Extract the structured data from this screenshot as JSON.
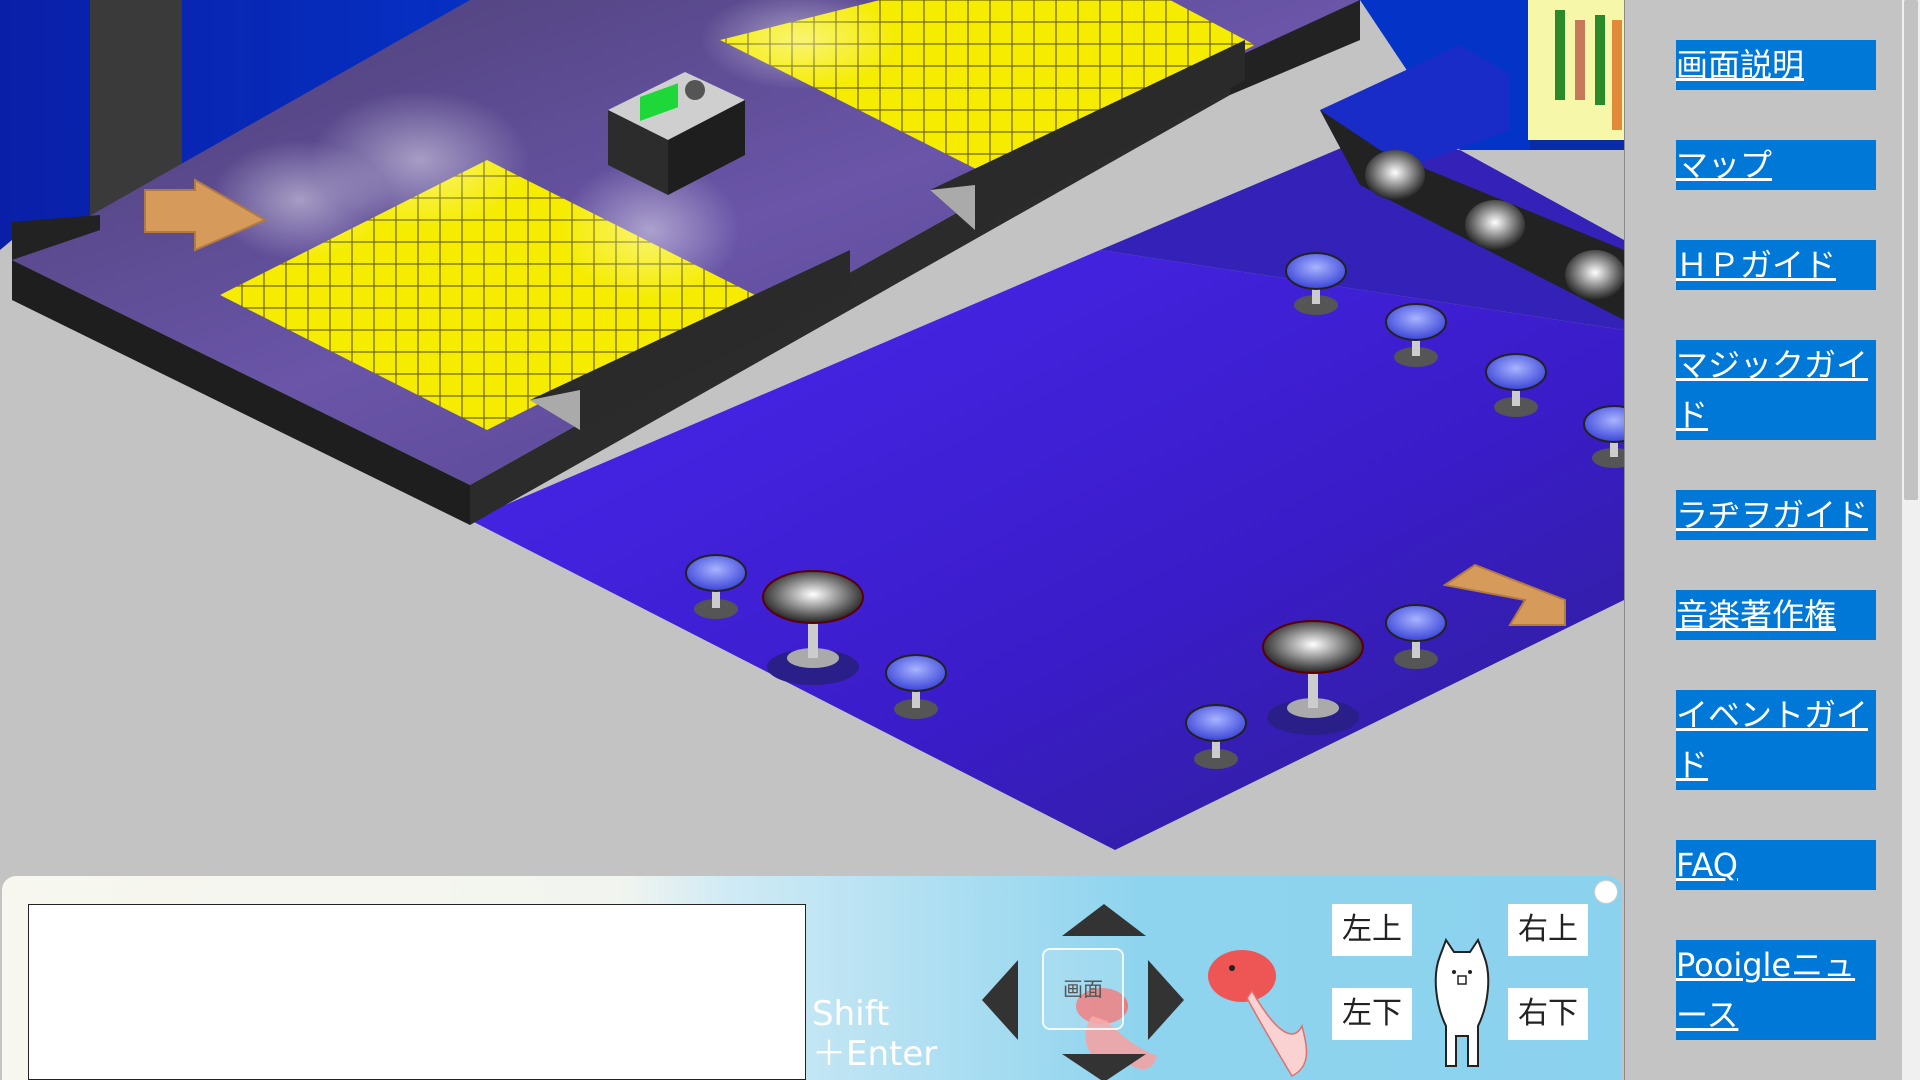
{
  "sidebar": {
    "links": [
      {
        "label": "画面説明"
      },
      {
        "label": "マップ"
      },
      {
        "label": "ＨＰガイド"
      },
      {
        "label": "マジックガイド"
      },
      {
        "label": "ラヂヲガイド"
      },
      {
        "label": "音楽著作権"
      },
      {
        "label": "イベントガイド"
      },
      {
        "label": "FAQ"
      },
      {
        "label": "Pooigleニュース"
      }
    ]
  },
  "controls": {
    "chat_value": "",
    "shift_line1": "Shift",
    "shift_line2": "＋Enter",
    "screen_button": "画面",
    "upper_left": "左上",
    "upper_right": "右上",
    "lower_left": "左下",
    "lower_right": "右下"
  },
  "colors": {
    "floor": "#3a1fd0",
    "stage_top": "#5b4a8c",
    "dance_tile": "#f7f000",
    "stool": "#4d5de8",
    "arrow": "#d9a05f",
    "link_bg": "#0078d7"
  },
  "icons": {
    "up": "triangle-up-icon",
    "down": "triangle-down-icon",
    "left": "triangle-left-icon",
    "right": "triangle-right-icon",
    "mascot": "cat-mascot-icon",
    "goldfish": "goldfish-icon"
  }
}
